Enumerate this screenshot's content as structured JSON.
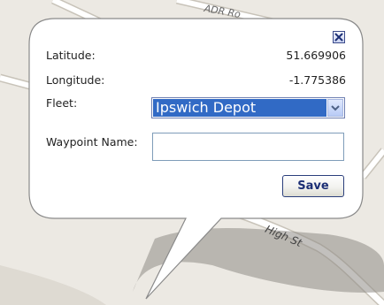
{
  "map": {
    "street_high": "High St",
    "street_top": "ADR Ro"
  },
  "popup": {
    "close_icon": "close-x-icon",
    "latitude_label": "Latitude:",
    "latitude_value": "51.669906",
    "longitude_label": "Longitude:",
    "longitude_value": "-1.775386",
    "fleet_label": "Fleet:",
    "fleet_selected": "Ipswich Depot",
    "fleet_arrow_icon": "chevron-down-icon",
    "waypoint_label": "Waypoint Name:",
    "waypoint_value": "",
    "save_label": "Save"
  },
  "colors": {
    "map_background": "#ece9e3",
    "road_fill": "#ffffff",
    "select_highlight": "#316ac5",
    "button_text": "#1c2f75"
  }
}
